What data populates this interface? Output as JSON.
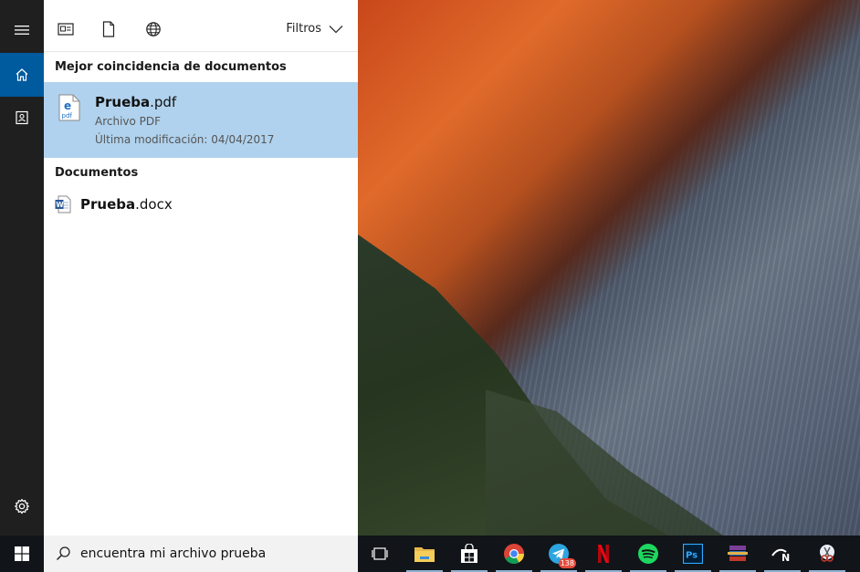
{
  "toolbar": {
    "filters_label": "Filtros"
  },
  "best_match": {
    "section_title": "Mejor coincidencia de documentos",
    "name_bold": "Prueba",
    "name_ext": ".pdf",
    "type": "Archivo PDF",
    "modified": "Última modificación: 04/04/2017"
  },
  "documents": {
    "section_title": "Documentos",
    "items": [
      {
        "name_bold": "Prueba",
        "name_ext": ".docx"
      }
    ]
  },
  "search": {
    "value": "encuentra mi archivo prueba"
  },
  "taskbar": {
    "apps": [
      {
        "name": "task-view-icon"
      },
      {
        "name": "file-explorer-icon"
      },
      {
        "name": "store-icon"
      },
      {
        "name": "chrome-icon"
      },
      {
        "name": "telegram-icon",
        "badge": "138"
      },
      {
        "name": "netflix-icon"
      },
      {
        "name": "spotify-icon"
      },
      {
        "name": "photoshop-icon"
      },
      {
        "name": "winrar-icon"
      },
      {
        "name": "n-app-icon"
      },
      {
        "name": "snipping-tool-icon"
      }
    ]
  },
  "colors": {
    "accent": "#005a9e",
    "selection": "#b0d2ee",
    "rail": "#1f1f1f"
  }
}
